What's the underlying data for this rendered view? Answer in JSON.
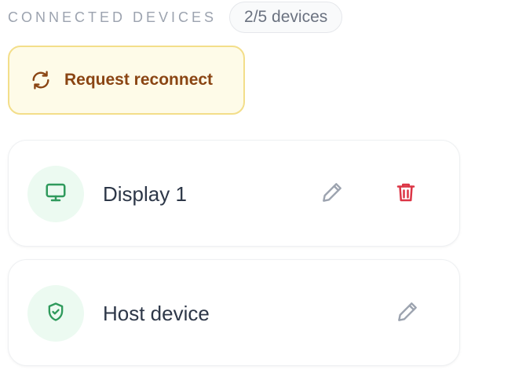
{
  "header": {
    "title": "CONNECTED DEVICES",
    "count_badge": "2/5 devices"
  },
  "reconnect": {
    "label": "Request reconnect",
    "icon": "refresh-icon"
  },
  "devices": [
    {
      "name": "Display 1",
      "icon": "monitor-icon",
      "actions": [
        "edit-icon",
        "trash-icon"
      ]
    },
    {
      "name": "Host device",
      "icon": "shield-check-icon",
      "actions": [
        "edit-icon"
      ]
    }
  ],
  "colors": {
    "title": "#9ca3af",
    "reconnect_bg": "#fefbe8",
    "reconnect_border": "#f3de8a",
    "reconnect_text": "#8a4513",
    "device_icon_bg": "#ecfaf1",
    "device_icon": "#2f9a5c",
    "edit_icon": "#9ca3af",
    "delete_icon": "#dc3545",
    "device_name": "#2d3748"
  }
}
